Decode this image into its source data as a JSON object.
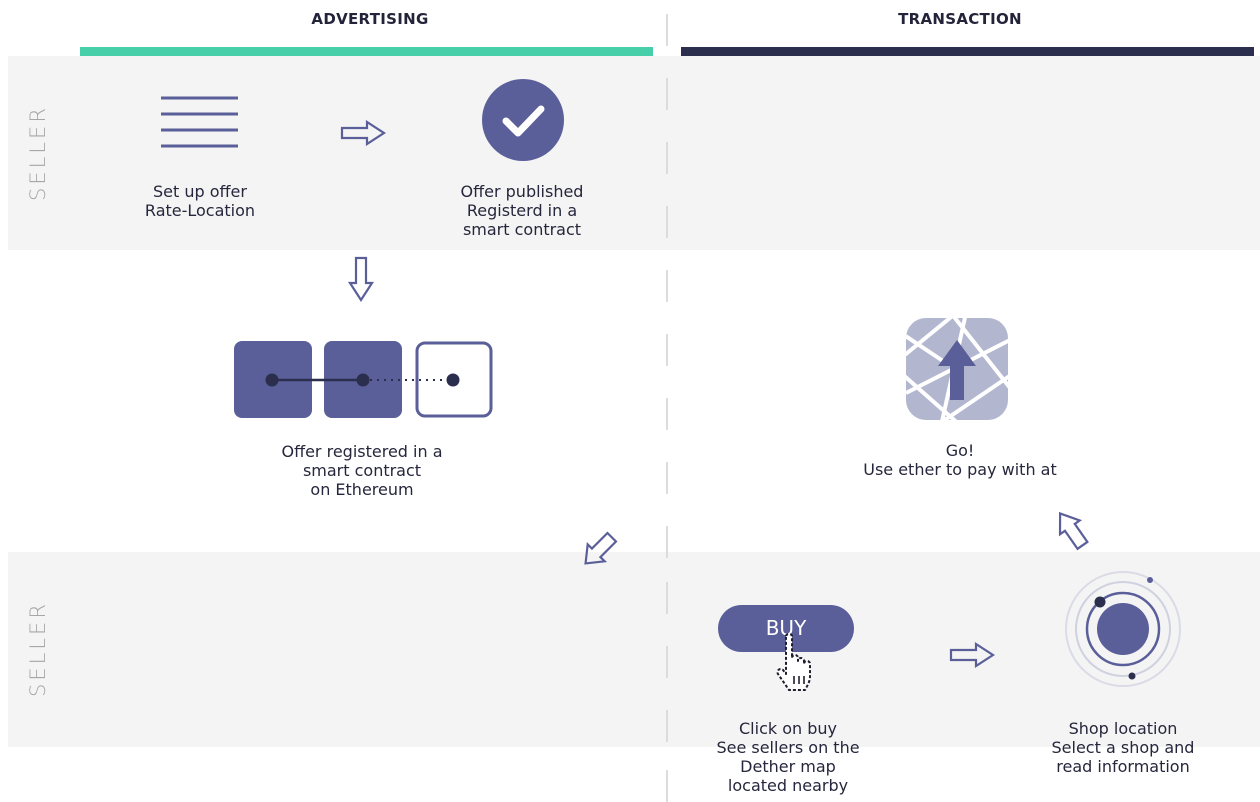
{
  "columns": {
    "advertising": "ADVERTISING",
    "transaction": "TRANSACTION"
  },
  "colors": {
    "advertising_bar": "#46cfa9",
    "transaction_bar": "#2c2e4e",
    "icon_primary": "#5a5f99",
    "band_bg": "#f4f4f4"
  },
  "rows": {
    "top_label": "SELLER",
    "bottom_label": "SELLER"
  },
  "steps": {
    "setup_offer": {
      "icon": "list-icon",
      "lines": [
        "Set up offer",
        "Rate-Location"
      ]
    },
    "offer_published": {
      "icon": "checkmark-icon",
      "lines": [
        "Offer published",
        "Registerd in a",
        "smart contract"
      ]
    },
    "offer_registered": {
      "icon": "blockchain-icon",
      "lines": [
        "Offer registered in a",
        "smart contract",
        "on Ethereum"
      ]
    },
    "go": {
      "icon": "map-navigation-icon",
      "lines": [
        "Go!",
        "Use ether to pay with at"
      ]
    },
    "click_buy": {
      "icon": "pointer-hand-icon",
      "button_label": "BUY",
      "lines": [
        "Click on buy",
        "See sellers on the",
        "Dether map",
        "located nearby"
      ]
    },
    "shop_location": {
      "icon": "location-orbit-icon",
      "lines": [
        "Shop location",
        "Select a shop and",
        "read information"
      ]
    }
  }
}
